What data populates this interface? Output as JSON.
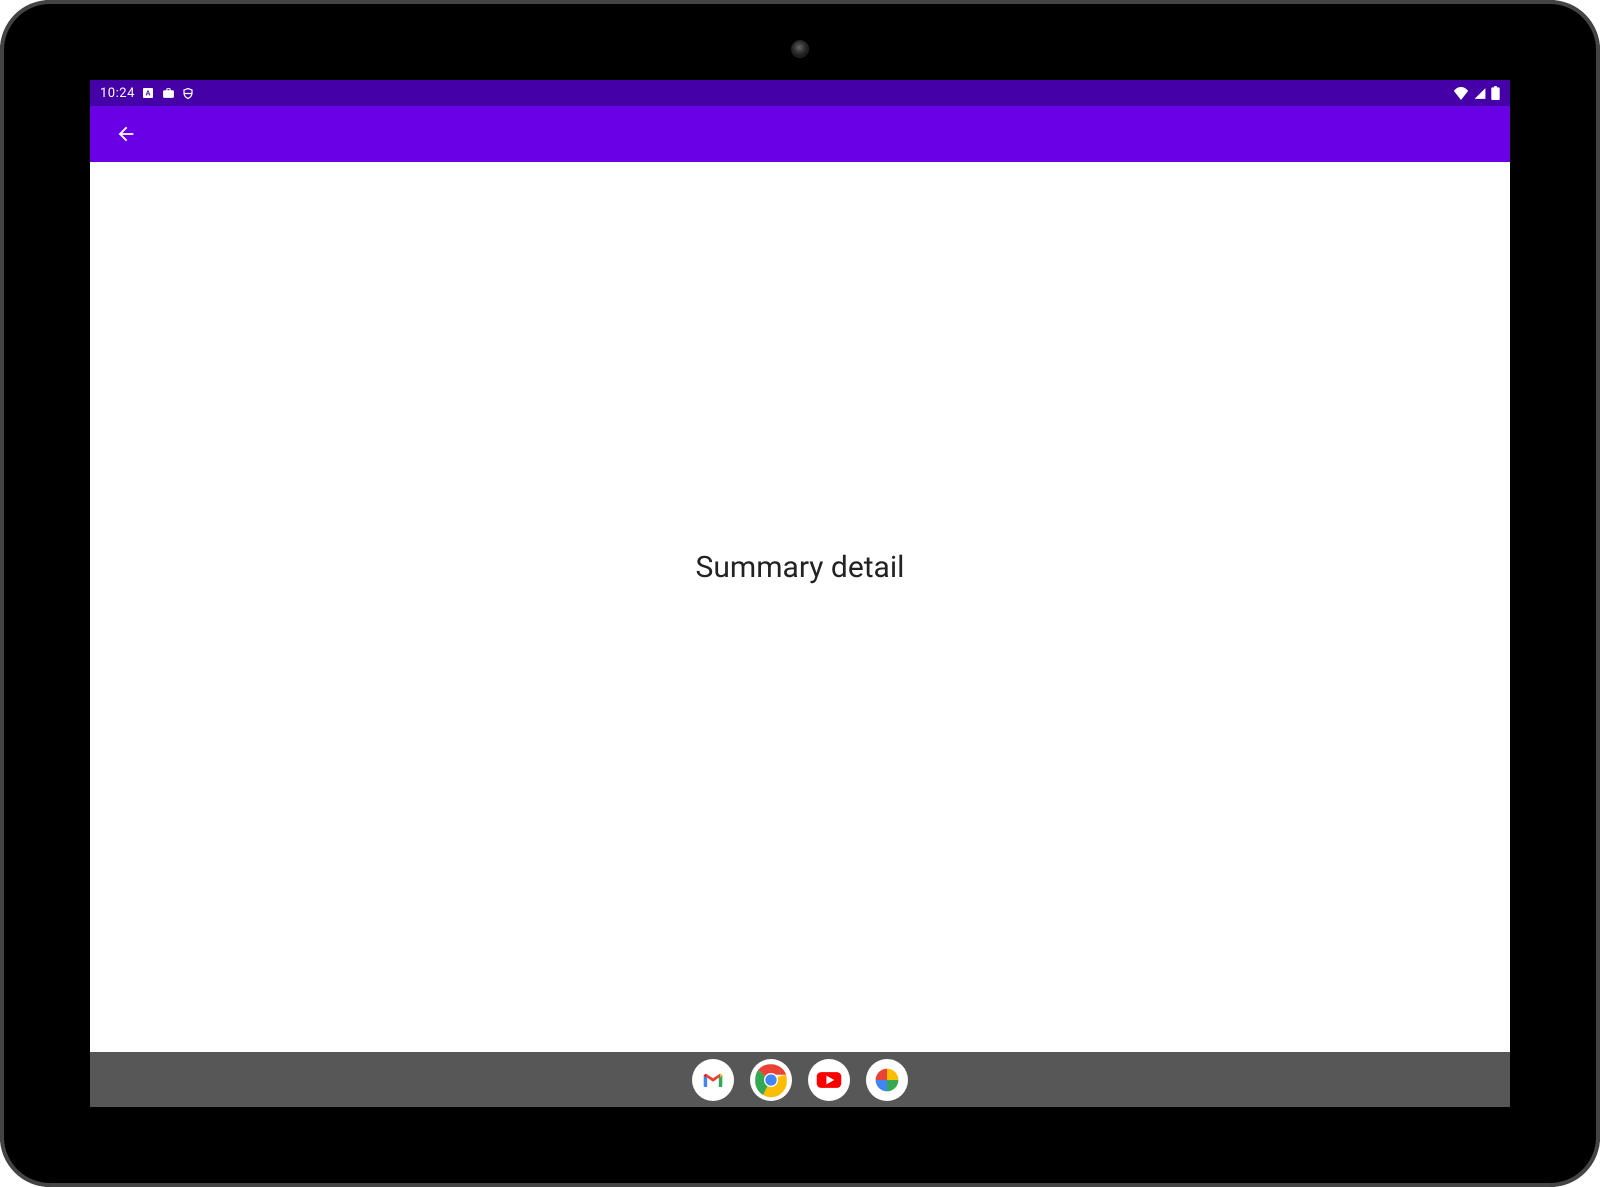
{
  "status_bar": {
    "time": "10:24",
    "icons_left": [
      "notification-a-icon",
      "briefcase-icon",
      "shield-icon"
    ],
    "icons_right": [
      "wifi-icon",
      "signal-icon",
      "battery-icon"
    ]
  },
  "app_bar": {
    "back_label": "Back"
  },
  "content": {
    "text": "Summary detail"
  },
  "taskbar": {
    "apps": [
      {
        "name": "gmail-icon",
        "label": "Gmail"
      },
      {
        "name": "chrome-icon",
        "label": "Chrome"
      },
      {
        "name": "youtube-icon",
        "label": "YouTube"
      },
      {
        "name": "photos-icon",
        "label": "Photos"
      }
    ]
  },
  "colors": {
    "status_bg": "#4600a8",
    "appbar_bg": "#6a00e6",
    "taskbar_bg": "#575757"
  }
}
